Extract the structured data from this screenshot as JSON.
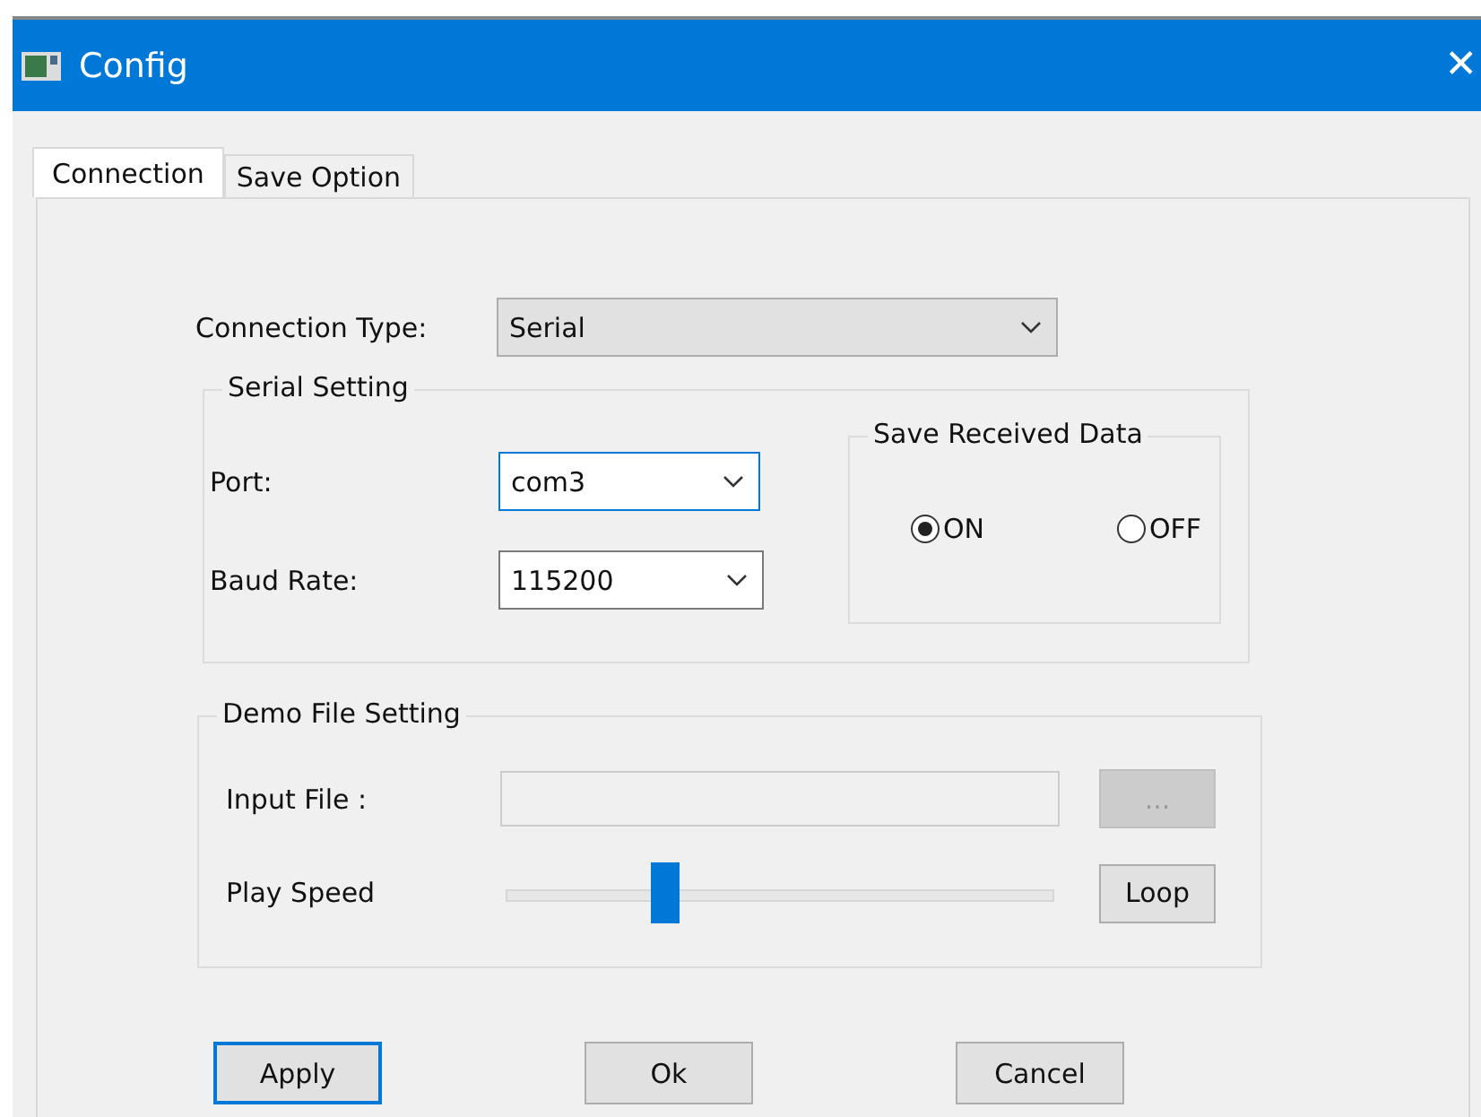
{
  "window": {
    "title": "Config",
    "close": "✕"
  },
  "tabs": [
    {
      "label": "Connection",
      "selected": true
    },
    {
      "label": "Save Option",
      "selected": false
    }
  ],
  "connection_type": {
    "label": "Connection Type:",
    "value": "Serial"
  },
  "serial_setting": {
    "title": "Serial Setting",
    "fields": [
      {
        "label": "Port:",
        "value": "com3",
        "focused": true
      },
      {
        "label": "Baud Rate:",
        "value": "115200",
        "focused": false
      }
    ],
    "save_received_data": {
      "title": "Save Received Data",
      "options": [
        {
          "label": "ON",
          "selected": true
        },
        {
          "label": "OFF",
          "selected": false
        }
      ]
    }
  },
  "demo_file_setting": {
    "title": "Demo File Setting",
    "input_file": {
      "label": "Input File :",
      "browse": "...",
      "browse_disabled": true
    },
    "play_speed": {
      "label": "Play Speed",
      "level": 0.29
    },
    "loop": "Loop"
  },
  "buttons": [
    {
      "label": "Apply",
      "focused": true
    },
    {
      "label": "Ok",
      "focused": false
    },
    {
      "label": "Cancel",
      "focused": false
    }
  ]
}
